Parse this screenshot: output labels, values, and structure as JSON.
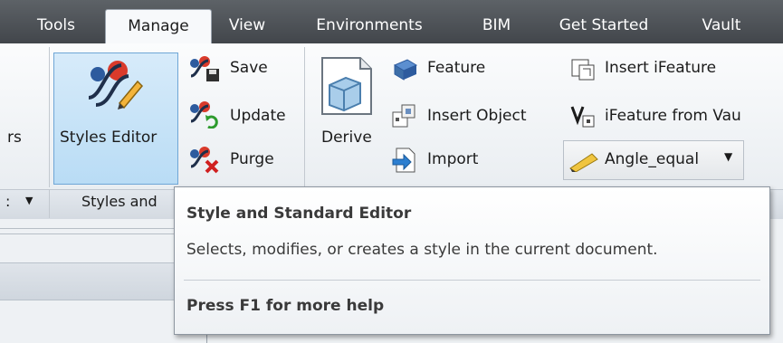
{
  "tabs": [
    "Tools",
    "Manage",
    "View",
    "Environments",
    "BIM",
    "Get Started",
    "Vault"
  ],
  "active_tab": "Manage",
  "ribbon": {
    "partial_left_label": "rs",
    "styles_editor_label": "Styles Editor",
    "save_label": "Save",
    "update_label": "Update",
    "purge_label": "Purge",
    "derive_label": "Derive",
    "feature_label": "Feature",
    "insert_object_label": "Insert Object",
    "import_label": "Import",
    "insert_ifeature_label": "Insert iFeature",
    "ifeature_from_vault_label": "iFeature from Vau",
    "dropdown_value": "Angle_equal",
    "group_styles_label": "Styles and",
    "group_partial_dropdown": ":"
  },
  "tooltip": {
    "title": "Style and Standard Editor",
    "description": "Selects, modifies, or creates a style in the current document.",
    "help": "Press F1 for more help"
  },
  "colors": {
    "tabbar": "#4b5055",
    "ribbon": "#f3f5f8",
    "selected_button": "#c4e2f7",
    "accent_red": "#d93a2b",
    "accent_blue": "#2d5b9e"
  }
}
